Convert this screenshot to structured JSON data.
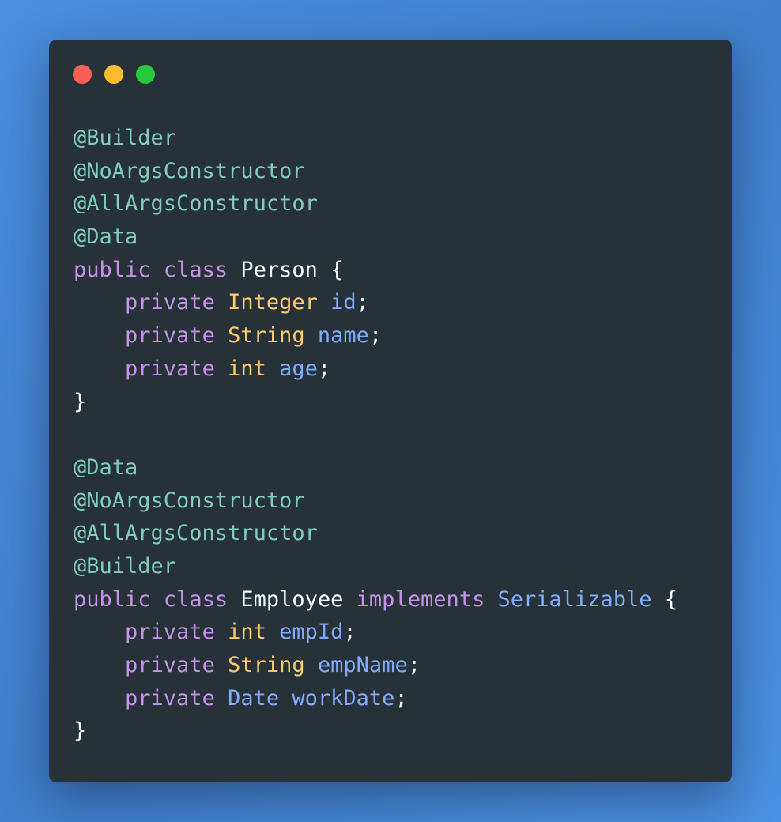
{
  "window": {
    "controls": [
      {
        "name": "close",
        "color": "#ff5f56"
      },
      {
        "name": "minimize",
        "color": "#ffbd2e"
      },
      {
        "name": "maximize",
        "color": "#27c93f"
      }
    ]
  },
  "code_lines": [
    [
      {
        "t": "annotation",
        "v": "@Builder"
      }
    ],
    [
      {
        "t": "annotation",
        "v": "@NoArgsConstructor"
      }
    ],
    [
      {
        "t": "annotation",
        "v": "@AllArgsConstructor"
      }
    ],
    [
      {
        "t": "annotation",
        "v": "@Data"
      }
    ],
    [
      {
        "t": "keyword",
        "v": "public"
      },
      {
        "t": "punct",
        "v": " "
      },
      {
        "t": "keyword",
        "v": "class"
      },
      {
        "t": "punct",
        "v": " "
      },
      {
        "t": "class",
        "v": "Person"
      },
      {
        "t": "punct",
        "v": " {"
      }
    ],
    [
      {
        "t": "punct",
        "v": "    "
      },
      {
        "t": "keyword",
        "v": "private"
      },
      {
        "t": "punct",
        "v": " "
      },
      {
        "t": "type",
        "v": "Integer"
      },
      {
        "t": "punct",
        "v": " "
      },
      {
        "t": "field",
        "v": "id"
      },
      {
        "t": "punct",
        "v": ";"
      }
    ],
    [
      {
        "t": "punct",
        "v": "    "
      },
      {
        "t": "keyword",
        "v": "private"
      },
      {
        "t": "punct",
        "v": " "
      },
      {
        "t": "type",
        "v": "String"
      },
      {
        "t": "punct",
        "v": " "
      },
      {
        "t": "field",
        "v": "name"
      },
      {
        "t": "punct",
        "v": ";"
      }
    ],
    [
      {
        "t": "punct",
        "v": "    "
      },
      {
        "t": "keyword",
        "v": "private"
      },
      {
        "t": "punct",
        "v": " "
      },
      {
        "t": "type",
        "v": "int"
      },
      {
        "t": "punct",
        "v": " "
      },
      {
        "t": "field",
        "v": "age"
      },
      {
        "t": "punct",
        "v": ";"
      }
    ],
    [
      {
        "t": "punct",
        "v": "}"
      }
    ],
    [],
    [
      {
        "t": "annotation",
        "v": "@Data"
      }
    ],
    [
      {
        "t": "annotation",
        "v": "@NoArgsConstructor"
      }
    ],
    [
      {
        "t": "annotation",
        "v": "@AllArgsConstructor"
      }
    ],
    [
      {
        "t": "annotation",
        "v": "@Builder"
      }
    ],
    [
      {
        "t": "keyword",
        "v": "public"
      },
      {
        "t": "punct",
        "v": " "
      },
      {
        "t": "keyword",
        "v": "class"
      },
      {
        "t": "punct",
        "v": " "
      },
      {
        "t": "class",
        "v": "Employee"
      },
      {
        "t": "punct",
        "v": " "
      },
      {
        "t": "keyword",
        "v": "implements"
      },
      {
        "t": "punct",
        "v": " "
      },
      {
        "t": "iface",
        "v": "Serializable"
      },
      {
        "t": "punct",
        "v": " {"
      }
    ],
    [
      {
        "t": "punct",
        "v": "    "
      },
      {
        "t": "keyword",
        "v": "private"
      },
      {
        "t": "punct",
        "v": " "
      },
      {
        "t": "type",
        "v": "int"
      },
      {
        "t": "punct",
        "v": " "
      },
      {
        "t": "field",
        "v": "empId"
      },
      {
        "t": "punct",
        "v": ";"
      }
    ],
    [
      {
        "t": "punct",
        "v": "    "
      },
      {
        "t": "keyword",
        "v": "private"
      },
      {
        "t": "punct",
        "v": " "
      },
      {
        "t": "type",
        "v": "String"
      },
      {
        "t": "punct",
        "v": " "
      },
      {
        "t": "field",
        "v": "empName"
      },
      {
        "t": "punct",
        "v": ";"
      }
    ],
    [
      {
        "t": "punct",
        "v": "    "
      },
      {
        "t": "keyword",
        "v": "private"
      },
      {
        "t": "punct",
        "v": " "
      },
      {
        "t": "iface",
        "v": "Date"
      },
      {
        "t": "punct",
        "v": " "
      },
      {
        "t": "field",
        "v": "workDate"
      },
      {
        "t": "punct",
        "v": ";"
      }
    ],
    [
      {
        "t": "punct",
        "v": "}"
      }
    ]
  ]
}
